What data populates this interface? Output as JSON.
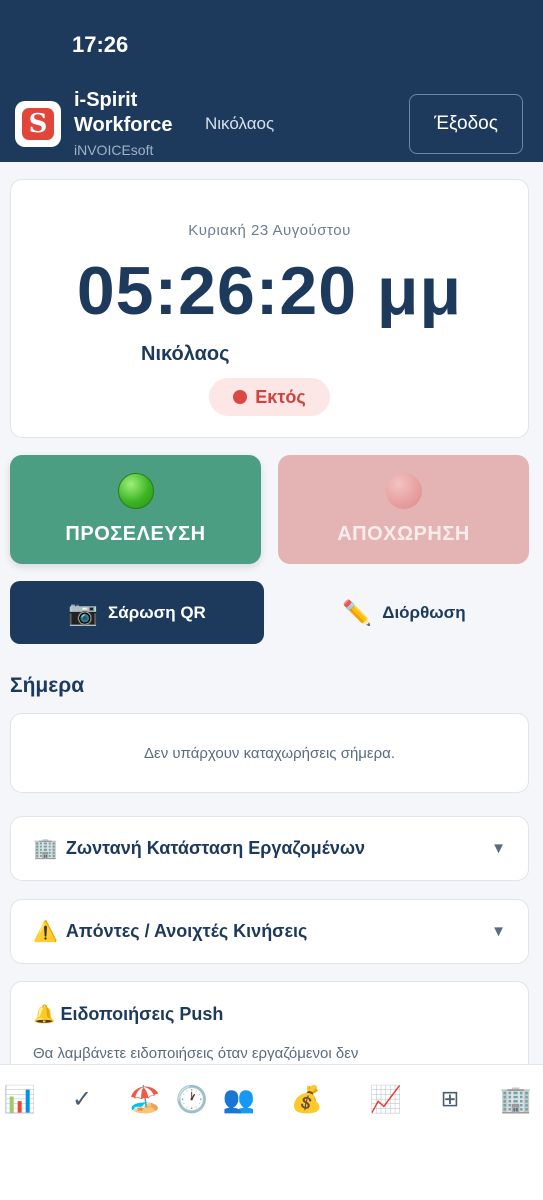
{
  "status_bar": {
    "time": "17:26"
  },
  "header": {
    "logo_letter": "S",
    "app_name": "i-Spirit Workforce",
    "app_sub": "iNVOICEsoft",
    "user_name": "Νικόλαος",
    "logout_label": "Έξοδος"
  },
  "clock_card": {
    "date": "Κυριακή 23 Αυγούστου",
    "time": "05:26:20 μμ",
    "name": "Νικόλαος",
    "status": "Εκτός"
  },
  "actions": {
    "checkin_label": "ΠΡΟΣΕΛΕΥΣΗ",
    "checkout_label": "ΑΠΟΧΩΡΗΣΗ",
    "qr_icon": "📷",
    "qr_label": "Σάρωση QR",
    "fix_icon": "✏️",
    "fix_label": "Διόρθωση"
  },
  "today": {
    "title": "Σήμερα",
    "empty_text": "Δεν υπάρχουν καταχωρήσεις σήμερα."
  },
  "accordions": [
    {
      "icon": "🏢",
      "label": "Ζωντανή Κατάσταση Εργαζομένων",
      "chevron": "▼"
    },
    {
      "icon": "⚠️",
      "label": "Απόντες / Ανοιχτές Κινήσεις",
      "chevron": "▼"
    }
  ],
  "push": {
    "icon": "🔔",
    "title": "Ειδοποιήσεις Push",
    "description": "Θα λαμβάνετε ειδοποιήσεις όταν εργαζόμενοι δεν"
  },
  "tabbar": [
    {
      "name": "reports",
      "icon": "📊"
    },
    {
      "name": "approvals",
      "icon": "✓"
    },
    {
      "name": "leave",
      "icon": "🏖️"
    },
    {
      "name": "history",
      "icon": "🕐"
    },
    {
      "name": "employees",
      "icon": "👥"
    },
    {
      "name": "payroll",
      "icon": "💰"
    },
    {
      "name": "stats",
      "icon": "📈"
    },
    {
      "name": "more",
      "icon": "⊞"
    },
    {
      "name": "company",
      "icon": "🏢"
    }
  ],
  "colors": {
    "primary": "#1d3a5c",
    "checkin": "#4c9e82",
    "checkout": "#e4b4b4",
    "status_out": "#d0423d"
  }
}
